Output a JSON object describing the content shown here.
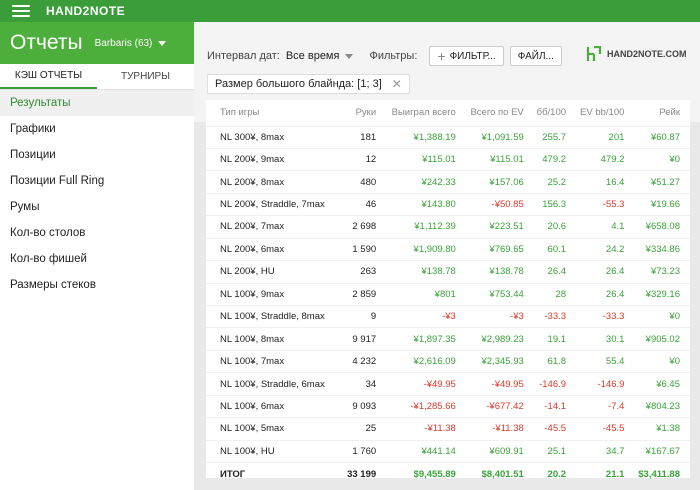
{
  "app": {
    "brand": "HAND2NOTE"
  },
  "sidebar": {
    "title": "Отчеты",
    "user": "Barbaris (63)",
    "tabs": [
      "КЭШ ОТЧЕТЫ",
      "ТУРНИРЫ"
    ],
    "items": [
      "Результаты",
      "Графики",
      "Позиции",
      "Позиции Full Ring",
      "Румы",
      "Кол-во столов",
      "Кол-во фишей",
      "Размеры стеков"
    ]
  },
  "toolbar": {
    "interval_label": "Интервал дат:",
    "interval_value": "Все время",
    "filters_label": "Фильтры:",
    "filters_button": "ФИЛЬТР...",
    "file_button": "ФАЙЛ...",
    "logo_text": "HAND2NOTE.COM",
    "chip_text": "Размер большого блайнда: [1; 3]"
  },
  "colors": {
    "accent": "#4caf3c",
    "positive": "#3aa33a",
    "negative": "#d93b2b"
  },
  "table": {
    "headers": [
      "Тип игры",
      "Руки",
      "Выиграл всего",
      "Всего по EV",
      "бб/100",
      "EV bb/100",
      "Рейк"
    ],
    "rows": [
      [
        "NL 300¥, 8max",
        "181",
        "¥1,388.19",
        "¥1,091.59",
        "255.7",
        "201",
        "¥60.87"
      ],
      [
        "NL 200¥, 9max",
        "12",
        "¥115.01",
        "¥115.01",
        "479.2",
        "479.2",
        "¥0"
      ],
      [
        "NL 200¥, 8max",
        "480",
        "¥242.33",
        "¥157.06",
        "25.2",
        "16.4",
        "¥51.27"
      ],
      [
        "NL 200¥, Straddle, 7max",
        "46",
        "¥143.80",
        "-¥50.85",
        "156.3",
        "-55.3",
        "¥19.66"
      ],
      [
        "NL 200¥, 7max",
        "2 698",
        "¥1,112.39",
        "¥223.51",
        "20.6",
        "4.1",
        "¥658.08"
      ],
      [
        "NL 200¥, 6max",
        "1 590",
        "¥1,909.80",
        "¥769.65",
        "60.1",
        "24.2",
        "¥334.86"
      ],
      [
        "NL 200¥, HU",
        "263",
        "¥138.78",
        "¥138.78",
        "26.4",
        "26.4",
        "¥73.23"
      ],
      [
        "NL 100¥, 9max",
        "2 859",
        "¥801",
        "¥753.44",
        "28",
        "26.4",
        "¥329.16"
      ],
      [
        "NL 100¥, Straddle, 8max",
        "9",
        "-¥3",
        "-¥3",
        "-33.3",
        "-33.3",
        "¥0"
      ],
      [
        "NL 100¥, 8max",
        "9 917",
        "¥1,897.35",
        "¥2,989.23",
        "19.1",
        "30.1",
        "¥905.02"
      ],
      [
        "NL 100¥, 7max",
        "4 232",
        "¥2,616.09",
        "¥2,345.93",
        "61.8",
        "55.4",
        "¥0"
      ],
      [
        "NL 100¥, Straddle, 6max",
        "34",
        "-¥49.95",
        "-¥49.95",
        "-146.9",
        "-146.9",
        "¥6.45"
      ],
      [
        "NL 100¥, 6max",
        "9 093",
        "-¥1,285.66",
        "-¥677.42",
        "-14.1",
        "-7.4",
        "¥804.23"
      ],
      [
        "NL 100¥, 5max",
        "25",
        "-¥11.38",
        "-¥11.38",
        "-45.5",
        "-45.5",
        "¥1.38"
      ],
      [
        "NL 100¥, HU",
        "1 760",
        "¥441.14",
        "¥609.91",
        "25.1",
        "34.7",
        "¥167.67"
      ]
    ],
    "total": [
      "ИТОГ",
      "33 199",
      "$9,455.89",
      "$8,401.51",
      "20.2",
      "21.1",
      "$3,411.88"
    ]
  }
}
